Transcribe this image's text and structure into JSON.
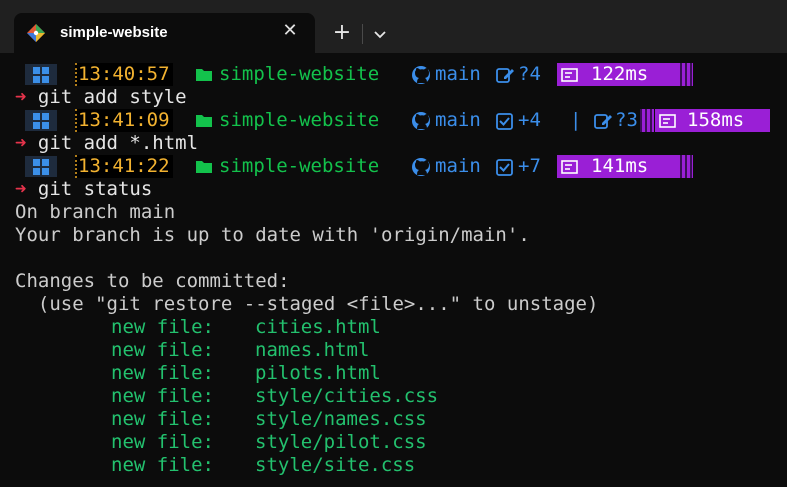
{
  "window": {
    "tab_title": "simple-website",
    "tab_icon": "git-diamond-icon",
    "new_tab_symbol": "+",
    "close_symbol": "✕"
  },
  "colors": {
    "background": "#0c0c0c",
    "titlebar": "#202020",
    "time": "#f2b230",
    "folder": "#13c24c",
    "git": "#3b8eea",
    "timer_badge": "#9a1fd6",
    "prompt_arrow": "#e5334b",
    "staged_file": "#23c16e"
  },
  "prompts": [
    {
      "time": "13:40:57",
      "folder": "simple-website",
      "branch": "main",
      "status_edit": "?4",
      "duration": "122ms",
      "command": "git add style"
    },
    {
      "time": "13:41:09",
      "folder": "simple-website",
      "branch": "main",
      "status_staged": "+4",
      "divider": "|",
      "status_edit": "?3",
      "duration": "158ms",
      "command": "git add *.html"
    },
    {
      "time": "13:41:22",
      "folder": "simple-website",
      "branch": "main",
      "status_staged": "+7",
      "duration": "141ms",
      "command": "git status"
    }
  ],
  "output": {
    "line1": "On branch main",
    "line2": "Your branch is up to date with 'origin/main'.",
    "line3": "",
    "line4": "Changes to be committed:",
    "line5": "  (use \"git restore --staged <file>...\" to unstage)",
    "files": [
      {
        "label": "new file:",
        "path": "cities.html"
      },
      {
        "label": "new file:",
        "path": "names.html"
      },
      {
        "label": "new file:",
        "path": "pilots.html"
      },
      {
        "label": "new file:",
        "path": "style/cities.css"
      },
      {
        "label": "new file:",
        "path": "style/names.css"
      },
      {
        "label": "new file:",
        "path": "style/pilot.css"
      },
      {
        "label": "new file:",
        "path": "style/site.css"
      }
    ]
  },
  "glyphs": {
    "prompt_arrow": "➜"
  }
}
